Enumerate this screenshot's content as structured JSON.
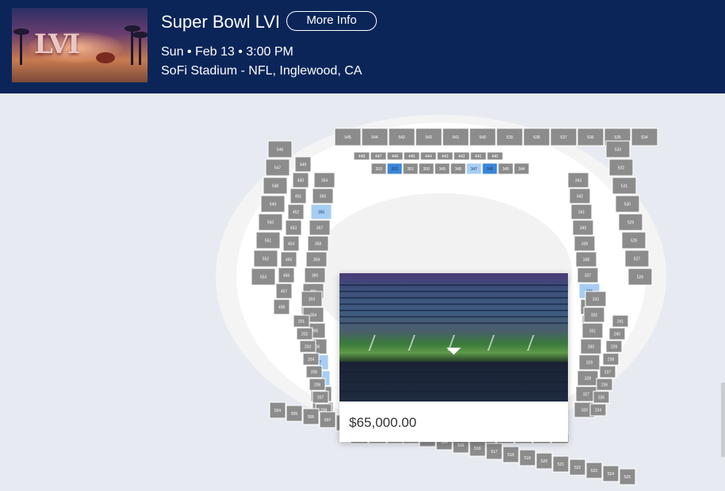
{
  "event": {
    "title": "Super Bowl LVI",
    "more_info_label": "More Info",
    "datetime": "Sun • Feb 13 • 3:00 PM",
    "venue": "SoFi Stadium - NFL, Inglewood, CA",
    "thumbnail_text": "LVI"
  },
  "popup": {
    "price": "$65,000.00"
  },
  "colors": {
    "header_bg": "#0b2559",
    "section_gray": "#8c8c8c",
    "section_available_light": "#a7cdf2",
    "section_available_dark": "#3b86d8",
    "page_bg": "#e7ebf1"
  },
  "seat_map": {
    "outer_top": [
      "545",
      "544",
      "543",
      "542",
      "541",
      "540",
      "539",
      "538",
      "537",
      "536",
      "535",
      "534"
    ],
    "outer_left": [
      "546",
      "547",
      "548",
      "549",
      "550",
      "551",
      "552",
      "553"
    ],
    "outer_right": [
      "533",
      "532",
      "531",
      "530",
      "529",
      "528",
      "527",
      "526"
    ],
    "outer_bottom": [
      "504",
      "505",
      "506",
      "507",
      "508",
      "509",
      "510",
      "511",
      "512",
      "513",
      "514",
      "515",
      "516",
      "517",
      "518",
      "519",
      "520",
      "521",
      "522",
      "523",
      "524",
      "525"
    ],
    "upper_top": [
      "448",
      "447",
      "446",
      "445",
      "444",
      "443",
      "442",
      "441",
      "440"
    ],
    "suite_top": [
      "353",
      "352",
      "351",
      "350",
      "349",
      "348",
      "347",
      "346",
      "345",
      "344"
    ],
    "upper_left": [
      "449",
      "450",
      "451",
      "452",
      "453",
      "454",
      "455",
      "456",
      "457",
      "458"
    ],
    "left_300": [
      "354",
      "355",
      "356",
      "357",
      "358",
      "359",
      "360",
      "361",
      "301",
      "302",
      "303",
      "304",
      "305",
      "306",
      "307",
      "308",
      "309",
      "310"
    ],
    "left_200": [
      "201",
      "202",
      "203",
      "204",
      "205",
      "206",
      "207",
      "208",
      "209",
      "210",
      "211",
      "212",
      "213",
      "214",
      "215"
    ],
    "right_300": [
      "343",
      "342",
      "341",
      "340",
      "339",
      "338",
      "337",
      "336",
      "335",
      "334",
      "333",
      "332",
      "331",
      "330",
      "329",
      "328",
      "327",
      "326"
    ],
    "right_200": [
      "241",
      "240",
      "239",
      "238",
      "237",
      "236",
      "235",
      "234",
      "233",
      "232",
      "231",
      "230",
      "229",
      "228",
      "227"
    ],
    "club_row": [
      "C102",
      "C104",
      "C106",
      "C108",
      "VIP 111",
      "VIP 112",
      "C113",
      "C114",
      "C116"
    ],
    "club_row2": [
      "C25",
      "C214",
      "C217",
      "VIP 218",
      "VIP 219",
      "VIP 220",
      "C221",
      "C222",
      "C224"
    ],
    "lower_bottom": [
      "217",
      "218",
      "219",
      "220",
      "221",
      "222",
      "223",
      "224",
      "225",
      "226",
      "227"
    ],
    "mid_bottom": [
      "409",
      "410",
      "411",
      "412",
      "413",
      "414",
      "415",
      "416",
      "417",
      "418",
      "419",
      "420"
    ]
  }
}
